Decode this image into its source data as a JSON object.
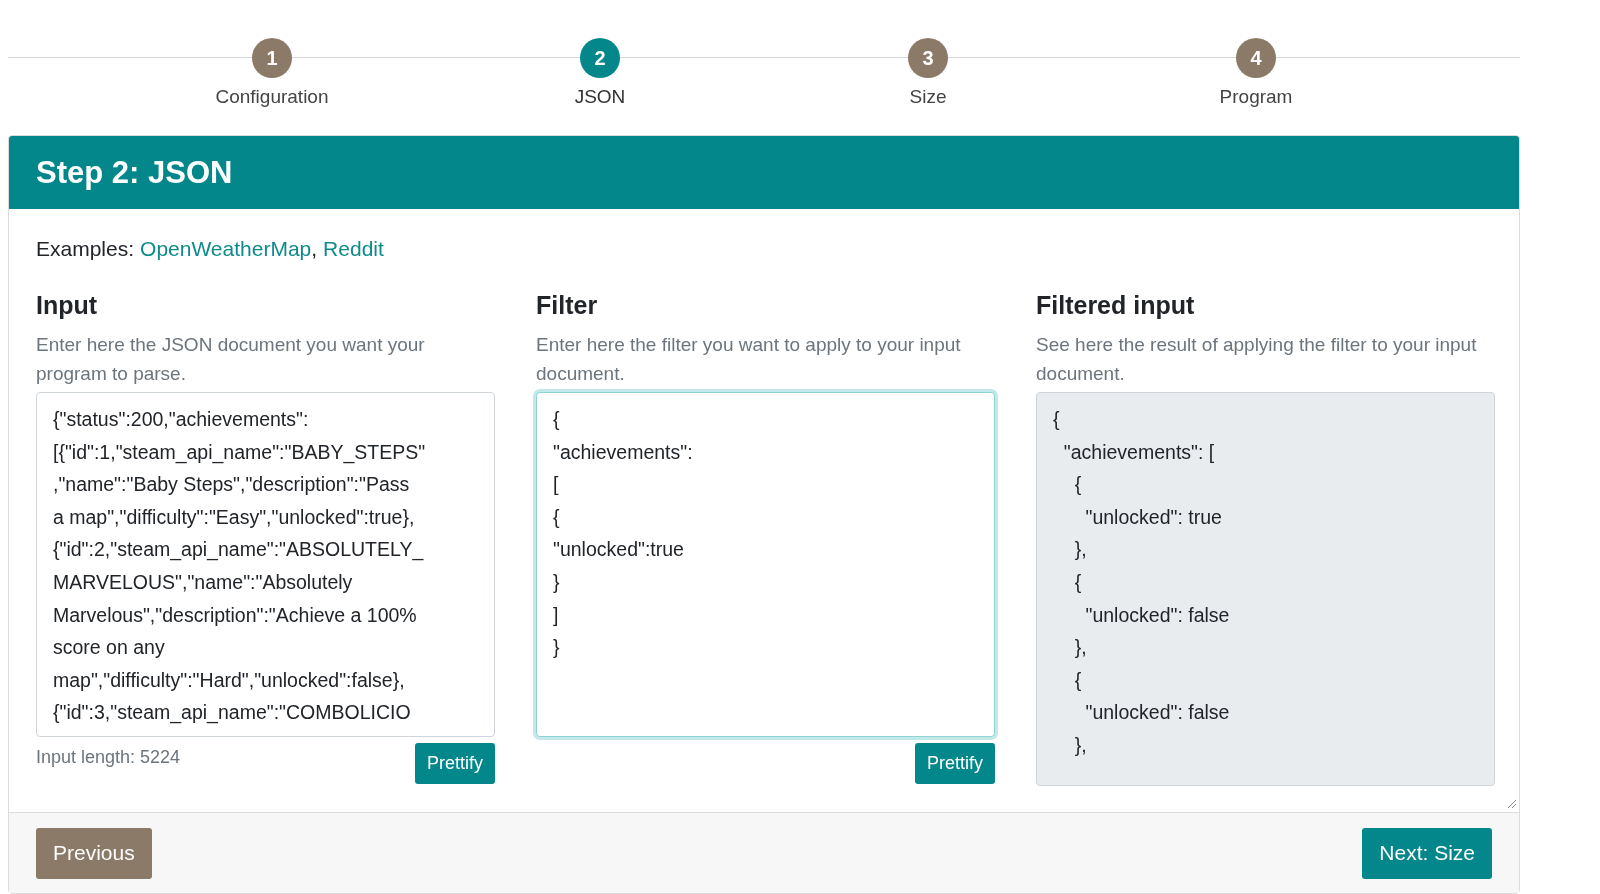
{
  "stepper": [
    {
      "number": "1",
      "label": "Configuration",
      "selected": false
    },
    {
      "number": "2",
      "label": "JSON",
      "selected": true
    },
    {
      "number": "3",
      "label": "Size",
      "selected": false
    },
    {
      "number": "4",
      "label": "Program",
      "selected": false
    }
  ],
  "card": {
    "title": "Step 2: JSON",
    "examples": {
      "label": "Examples:",
      "links": [
        "OpenWeatherMap",
        "Reddit"
      ],
      "separator": ","
    },
    "columns": [
      {
        "kind": "editable",
        "heading": "Input",
        "help": "Enter here the JSON document you want your program to parse.",
        "lines": [
          "{\"status\":200,\"achievements\":",
          "[{\"id\":1,\"steam_api_name\":\"BABY_STEPS\"",
          ",\"name\":\"Baby Steps\",\"description\":\"Pass",
          "a map\",\"difficulty\":\"Easy\",\"unlocked\":true},",
          "{\"id\":2,\"steam_api_name\":\"ABSOLUTELY_",
          "MARVELOUS\",\"name\":\"Absolutely",
          "Marvelous\",\"description\":\"Achieve a 100%",
          "score on any",
          "map\",\"difficulty\":\"Hard\",\"unlocked\":false},",
          "{\"id\":3,\"steam_api_name\":\"COMBOLICIO"
        ],
        "focused": false,
        "note": "Input length: 5224",
        "button": "Prettify"
      },
      {
        "kind": "editable",
        "heading": "Filter",
        "help": "Enter here the filter you want to apply to your input document.",
        "lines": [
          "{",
          "\"achievements\":",
          "[",
          "{",
          "\"unlocked\":true",
          "}",
          "]",
          "}"
        ],
        "focused": true,
        "button": "Prettify"
      },
      {
        "kind": "readonly",
        "heading": "Filtered input",
        "help": "See here the result of applying the filter to your input document.",
        "lines": [
          "{",
          "  \"achievements\": [",
          "    {",
          "      \"unlocked\": true",
          "    },",
          "    {",
          "      \"unlocked\": false",
          "    },",
          "    {",
          "      \"unlocked\": false",
          "    },"
        ]
      }
    ],
    "footer": {
      "previous": "Previous",
      "next": "Next: Size"
    }
  }
}
